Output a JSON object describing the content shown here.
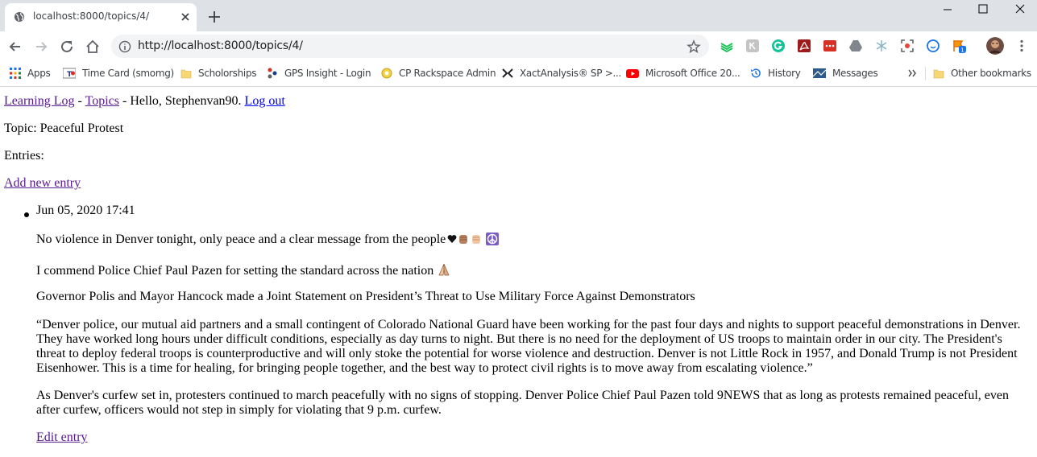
{
  "browser": {
    "tab": {
      "title": "localhost:8000/topics/4/",
      "favicon": "globe-icon"
    },
    "omnibox": {
      "url": "http://localhost:8000/topics/4/"
    },
    "bookmarks": [
      {
        "label": "Apps",
        "icon": "apps-grid-icon"
      },
      {
        "label": "Time Card (smomg)",
        "icon": "timecard-icon"
      },
      {
        "label": "Scholorships",
        "icon": "folder-icon"
      },
      {
        "label": "GPS Insight - Login",
        "icon": "gps-insight-icon"
      },
      {
        "label": "CP Rackspace Admin",
        "icon": "rackspace-icon"
      },
      {
        "label": "XactAnalysis® SP >...",
        "icon": "xact-icon"
      },
      {
        "label": "Microsoft Office 20...",
        "icon": "youtube-icon"
      },
      {
        "label": "History",
        "icon": "history-icon"
      },
      {
        "label": "Messages",
        "icon": "messages-icon"
      }
    ],
    "other_bookmarks": "Other bookmarks",
    "colors": {
      "tabstrip": "#dee1e6",
      "omnibox": "#f1f3f4",
      "link": "#0000ee",
      "visited_link": "#551a8b"
    }
  },
  "page": {
    "nav": {
      "site_link": "Learning Log",
      "sep1": " - ",
      "topics_link": "Topics",
      "greeting": " - Hello, Stephenvan90. ",
      "logout_link": "Log out"
    },
    "topic_line": "Topic: Peaceful Protest",
    "entries_label": "Entries:",
    "add_entry_link": "Add new entry",
    "entry": {
      "date": "Jun 05, 2020 17:41",
      "p1": "No violence in Denver tonight, only peace and a clear message from the people",
      "p1_emojis": [
        "black-heart-icon",
        "raised-fist-icon",
        "raised-fist-icon",
        "peace-symbol-icon"
      ],
      "p2": "I commend Police Chief Paul Pazen for setting the standard across the nation",
      "p2_emojis": [
        "praying-hands-icon"
      ],
      "p3": "Governor Polis and Mayor Hancock made a Joint Statement on President’s Threat to Use Military Force Against Demonstrators",
      "p4_lines": [
        "“Denver police, our mutual aid partners and a small contingent of Colorado National Guard have been working for the past four days and nights to support peaceful demonstrations in Denver.",
        "They have worked long hours under difficult conditions, especially as day turns to night. But there is no need for the deployment of US troops to maintain order in our city. The President's",
        "threat to deploy federal troops is counterproductive and will only stoke the potential for worse violence and destruction. Denver is not Little Rock in 1957, and Donald Trump is not President",
        "Eisenhower. This is a time for healing, for bringing people together, and the best way to protect civil rights is to move away from escalating violence.”"
      ],
      "p5_lines": [
        "As Denver's curfew set in, protesters continued to march peacefully with no signs of stopping. Denver Police Chief Paul Pazen told 9NEWS that as long as protests remained peaceful, even",
        "after curfew, officers would not step in simply for violating that 9 p.m. curfew."
      ],
      "edit_link": "Edit entry"
    }
  }
}
